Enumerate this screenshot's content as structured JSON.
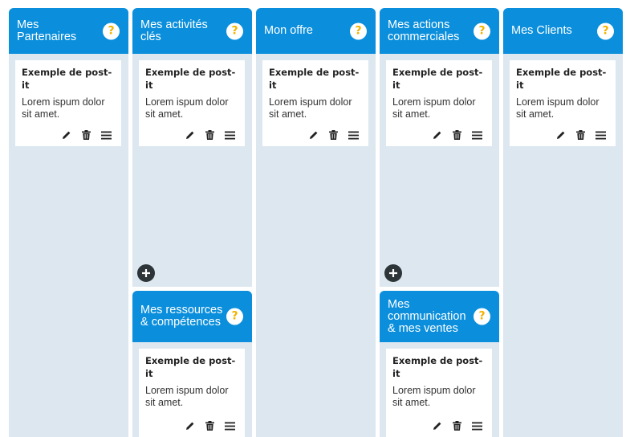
{
  "columns": {
    "partenaires": {
      "title": "Mes Partenaires"
    },
    "activites": {
      "title": "Mes activités clés"
    },
    "ressources": {
      "title": "Mes ressources & compétences"
    },
    "offre": {
      "title": "Mon offre"
    },
    "actions": {
      "title": "Mes actions commerciales"
    },
    "communication": {
      "title": "Mes communication & mes ventes"
    },
    "clients": {
      "title": "Mes Clients"
    }
  },
  "help_label": "?",
  "card": {
    "title": "Exemple de post-it",
    "body": "Lorem ispum dolor sit amet."
  },
  "icons": {
    "help": "question-icon",
    "edit": "pencil-icon",
    "delete": "trash-icon",
    "drag": "menu-icon",
    "add": "plus-icon"
  },
  "colors": {
    "header": "#0b8fdc",
    "column": "#dce7f0",
    "help": "#f1b400",
    "add_button": "#2d3539"
  }
}
